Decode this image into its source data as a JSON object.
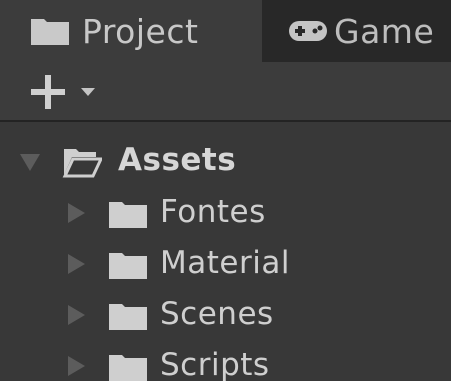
{
  "tabs": [
    {
      "label": "Project",
      "icon": "folder-icon",
      "active": true
    },
    {
      "label": "Game",
      "icon": "gamepad-icon",
      "active": false
    }
  ],
  "toolbar": {
    "add_icon": "plus-icon",
    "dropdown_icon": "chevron-down-icon"
  },
  "tree": {
    "root": {
      "label": "Assets",
      "expanded": true,
      "icon": "folder-open-icon"
    },
    "children": [
      {
        "label": "Fontes",
        "icon": "folder-icon"
      },
      {
        "label": "Material",
        "icon": "folder-icon"
      },
      {
        "label": "Scenes",
        "icon": "folder-icon"
      },
      {
        "label": "Scripts",
        "icon": "folder-icon"
      }
    ]
  },
  "colors": {
    "panel_bg": "#383838",
    "tab_active_bg": "#3c3c3c",
    "tab_inactive_bg": "#282828",
    "text": "#cfcfcf",
    "arrow": "#5c5c5c"
  }
}
